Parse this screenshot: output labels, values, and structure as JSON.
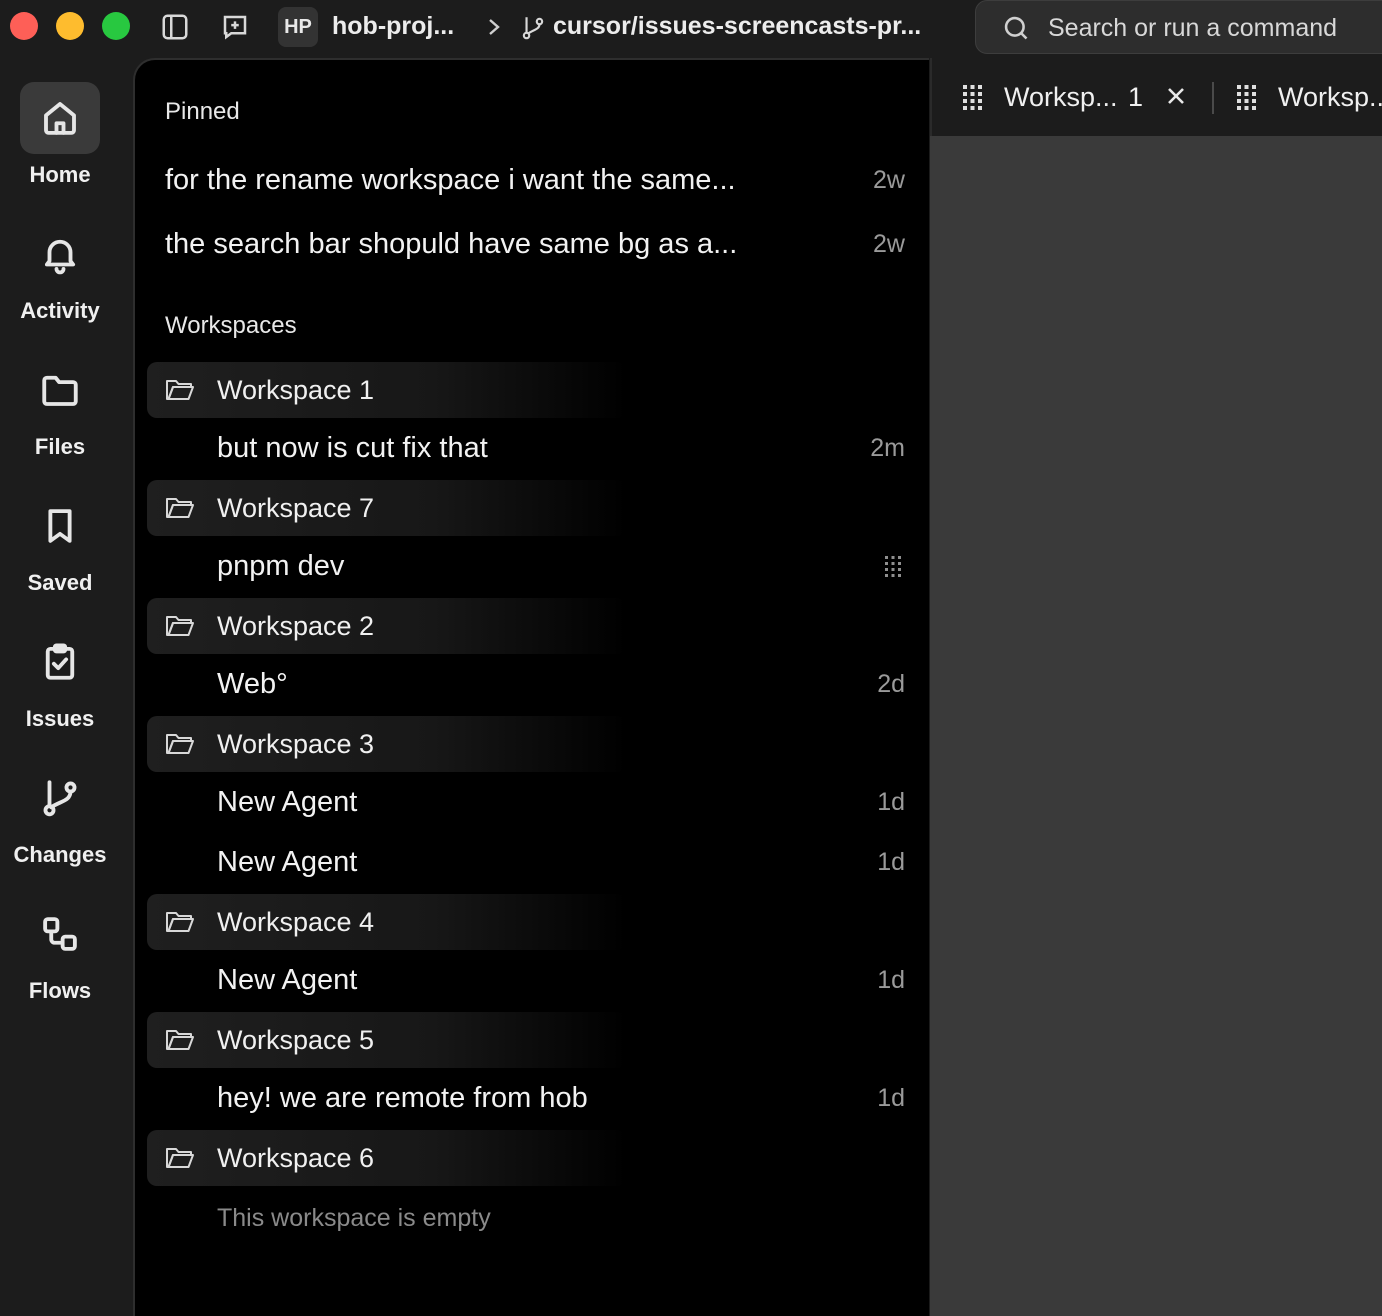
{
  "titlebar": {
    "project_badge": "HP",
    "project_name": "hob-proj...",
    "branch_name": "cursor/issues-screencasts-pr...",
    "search_placeholder": "Search or run a command"
  },
  "nav": {
    "items": [
      {
        "label": "Home",
        "icon": "home-icon",
        "active": true
      },
      {
        "label": "Activity",
        "icon": "bell-icon",
        "active": false
      },
      {
        "label": "Files",
        "icon": "folder-icon",
        "active": false
      },
      {
        "label": "Saved",
        "icon": "bookmark-icon",
        "active": false
      },
      {
        "label": "Issues",
        "icon": "clipboard-check-icon",
        "active": false
      },
      {
        "label": "Changes",
        "icon": "git-branch-icon",
        "active": false
      },
      {
        "label": "Flows",
        "icon": "flow-icon",
        "active": false
      }
    ]
  },
  "main": {
    "pinned_heading": "Pinned",
    "pinned": [
      {
        "text": "for the rename workspace i want the same...",
        "age": "2w"
      },
      {
        "text": "the search bar shopuld have same bg as a...",
        "age": "2w"
      }
    ],
    "workspaces_heading": "Workspaces",
    "workspaces": [
      {
        "name": "Workspace 1",
        "items": [
          {
            "text": "but now is cut fix that",
            "age": "2m"
          }
        ]
      },
      {
        "name": "Workspace 7",
        "items": [
          {
            "text": "pnpm dev",
            "age": "",
            "icon": "terminal-grid-icon"
          }
        ]
      },
      {
        "name": "Workspace 2",
        "items": [
          {
            "text": "Web°",
            "age": "2d"
          }
        ]
      },
      {
        "name": "Workspace 3",
        "items": [
          {
            "text": "New Agent",
            "age": "1d"
          },
          {
            "text": "New Agent",
            "age": "1d"
          }
        ]
      },
      {
        "name": "Workspace 4",
        "items": [
          {
            "text": "New Agent",
            "age": "1d"
          }
        ]
      },
      {
        "name": "Workspace 5",
        "items": [
          {
            "text": "hey! we are remote from hob",
            "age": "1d"
          }
        ]
      },
      {
        "name": "Workspace 6",
        "items": [],
        "empty_text": "This workspace is empty"
      }
    ]
  },
  "tabs": [
    {
      "label": "Worksp...",
      "count": "1",
      "closable": true
    },
    {
      "label": "Worksp..."
    }
  ]
}
